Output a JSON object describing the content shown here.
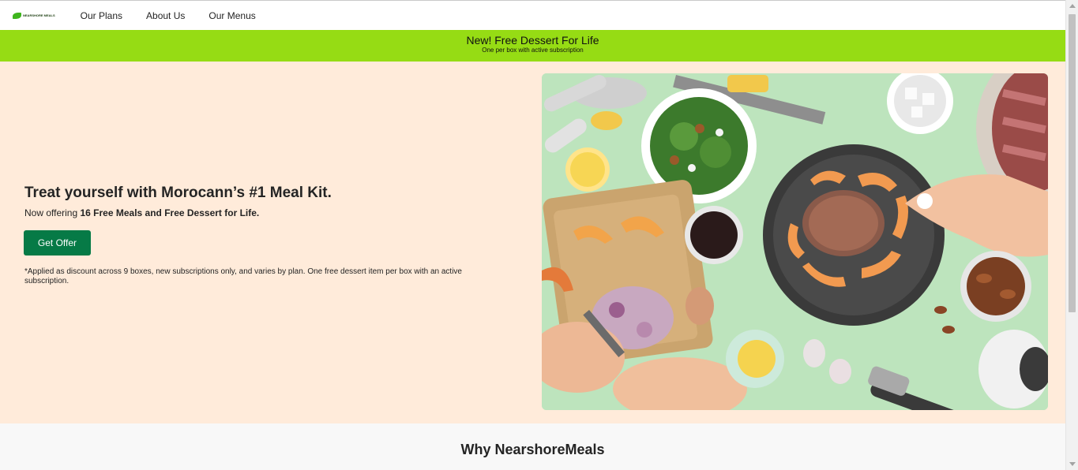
{
  "nav": {
    "logo_text": "NEARSHORE MEALS",
    "links": [
      "Our Plans",
      "About Us",
      "Our Menus"
    ]
  },
  "promo": {
    "title": "New! Free Dessert For Life",
    "subtitle": "One per box with active subscription"
  },
  "hero": {
    "title": "Treat yourself with Morocann’s #1 Meal Kit.",
    "sub_prefix": "Now offering ",
    "sub_bold": "16 Free Meals and Free Dessert for Life.",
    "cta_label": "Get Offer",
    "disclaimer": "*Applied as discount across 9 boxes, new subscriptions only, and varies by plan. One free dessert item per box with an active subscription."
  },
  "section": {
    "why_title": "Why NearshoreMeals"
  },
  "colors": {
    "promo_bg": "#96dc14",
    "hero_bg": "#ffebda",
    "cta_bg": "#067a46"
  }
}
